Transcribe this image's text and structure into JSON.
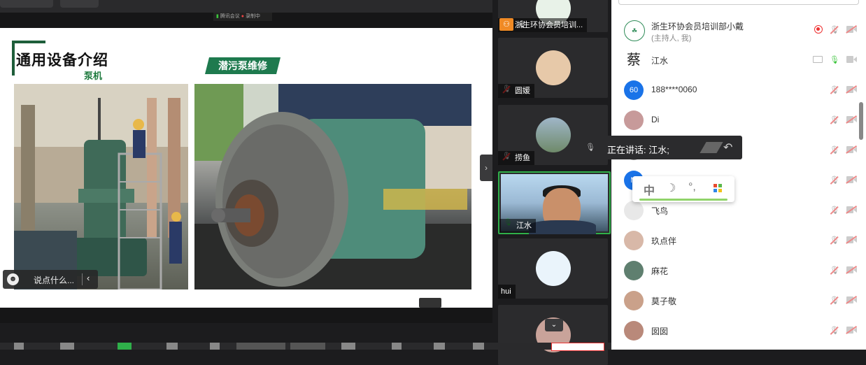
{
  "topbar": {
    "title": "录制中",
    "rec_label": "腾讯会议",
    "rec_status": "录制中"
  },
  "slide": {
    "title": "通用设备介绍",
    "subtitle": "泵机",
    "banner": "潜污泵维修"
  },
  "chat": {
    "placeholder": "说点什么..."
  },
  "video_tiles": [
    {
      "name": "浙生环协会员培训...",
      "muted": true
    },
    {
      "name": "圆媛",
      "muted": true
    },
    {
      "name": "捞鱼",
      "muted": true
    },
    {
      "name": "江水",
      "muted": false
    },
    {
      "name": "hui",
      "muted": true
    }
  ],
  "speaking": {
    "label": "正在讲话: 江水;"
  },
  "participants": [
    {
      "name": "浙生环协会员培训部小戴",
      "sub": "(主持人, 我)",
      "avatar_color": "#2e8b57"
    },
    {
      "name": "江水",
      "avatar_text": "蔡",
      "avatar_color": "#222222"
    },
    {
      "name": "188****0060",
      "avatar_text": "60",
      "avatar_color": "#1a73e8"
    },
    {
      "name": "Di",
      "avatar_color": "#c79a9a"
    },
    {
      "name": "",
      "avatar_color": "#8a8a8a"
    },
    {
      "name": "",
      "avatar_text": "M",
      "avatar_color": "#1a73e8"
    },
    {
      "name": "飞鸟",
      "avatar_color": "#b0b0b0"
    },
    {
      "name": "玖点伴",
      "avatar_color": "#d8b8a8"
    },
    {
      "name": "麻花",
      "avatar_color": "#5f7f6f"
    },
    {
      "name": "莫子敬",
      "avatar_color": "#caa18a"
    },
    {
      "name": "囡囡",
      "avatar_color": "#b9897a"
    }
  ],
  "ime_toolbar": {
    "lang": "中",
    "moon": "☽",
    "punct": "°,",
    "grid": "⊞"
  }
}
